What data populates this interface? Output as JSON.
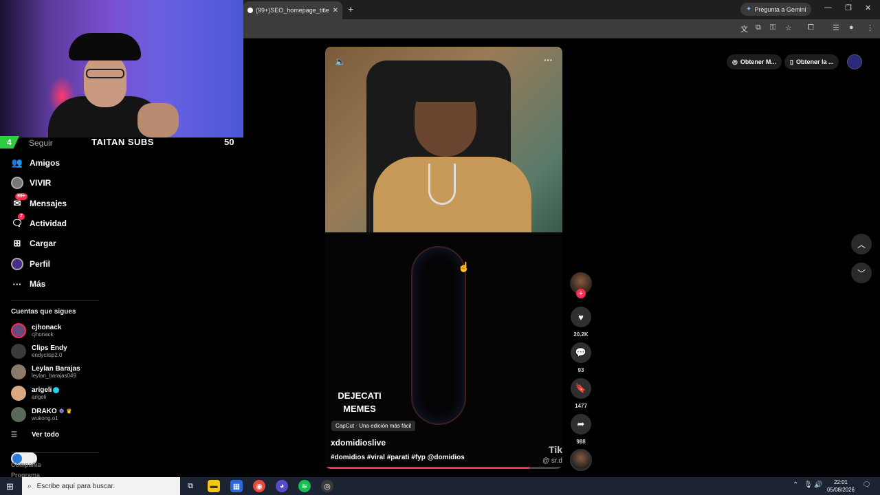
{
  "browser": {
    "tab_title": "(99+)SEO_homepage_title",
    "tab_close": "✕",
    "new_tab": "+",
    "gemini_label": "Pregunta a Gemini"
  },
  "webcam": {
    "sub_count_badge": "4",
    "subs_label": "TAITAN SUBS",
    "subs_count": "50"
  },
  "sidebar": {
    "items": [
      {
        "label": "Seguir"
      },
      {
        "label": "Amigos"
      },
      {
        "label": "VIVIR"
      },
      {
        "label": "Mensajes",
        "badge": "99+"
      },
      {
        "label": "Actividad",
        "badge": "7"
      },
      {
        "label": "Cargar"
      },
      {
        "label": "Perfil"
      },
      {
        "label": "Más"
      }
    ],
    "following_title": "Cuentas que sigues",
    "accounts": [
      {
        "name": "cjhonack",
        "handle": "cjhonack"
      },
      {
        "name": "Clips Endy",
        "handle": "endyclisp2.0"
      },
      {
        "name": "Leylan Barajas",
        "handle": "leylan_barajas049"
      },
      {
        "name": "arigeli",
        "handle": "arigeli"
      },
      {
        "name": "DRAKO",
        "handle": "wukong.o1"
      }
    ],
    "see_all": "Ver todo",
    "footer_company": "Compañía",
    "footer_program": "Programa"
  },
  "video": {
    "overlay_text_1": "DEJECATI",
    "overlay_text_2": "MEMES",
    "capcut_label": "CapCut · Una edición más fácil",
    "author": "xdomidioslive",
    "hashtags": "#domidios #viral #parati #fyp @domidios",
    "watermark": "Tik",
    "watermark_user": "@ sr.d",
    "progress": 0.86
  },
  "actions": {
    "likes": "20.2K",
    "comments": "93",
    "saves": "1477",
    "shares": "988"
  },
  "top_right": {
    "get_app_1": "Obtener M...",
    "get_app_2": "Obtener la ..."
  },
  "taskbar": {
    "search_placeholder": "Escribe aquí para buscar.",
    "time": "22:01",
    "date": "05/08/2026"
  },
  "colors": {
    "accent": "#fe2c55",
    "subs_green": "#2ecc40",
    "taskbar": "#1c2433"
  }
}
